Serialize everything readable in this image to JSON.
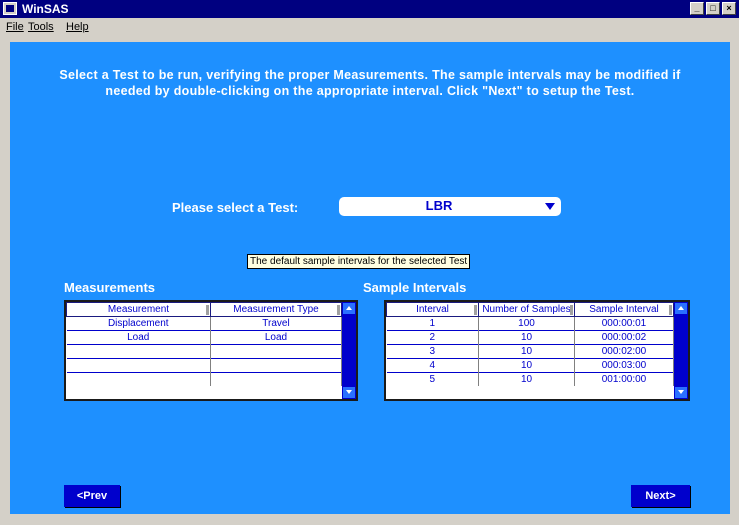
{
  "window": {
    "title": "WinSAS",
    "min_glyph": "_",
    "max_glyph": "□",
    "close_glyph": "×"
  },
  "menu": {
    "file": "File",
    "tools": "Tools",
    "help": "Help"
  },
  "instructions": "Select a Test to be run, verifying the proper Measurements.  The sample intervals may be modified if needed by double-clicking on the appropriate interval.  Click \"Next\" to setup the Test.",
  "test_select": {
    "label": "Please select a Test:",
    "value": "LBR"
  },
  "measurements": {
    "title": "Measurements",
    "columns": [
      "Measurement",
      "Measurement Type"
    ],
    "rows": [
      [
        "Displacement",
        "Travel"
      ],
      [
        "Load",
        "Load"
      ],
      [
        "",
        ""
      ],
      [
        "",
        ""
      ],
      [
        "",
        ""
      ]
    ]
  },
  "sample_intervals": {
    "title": "Sample Intervals",
    "columns": [
      "Interval",
      "Number of Samples",
      "Sample Interval"
    ],
    "rows": [
      [
        "1",
        "100",
        "000:00:01"
      ],
      [
        "2",
        "10",
        "000:00:02"
      ],
      [
        "3",
        "10",
        "000:02:00"
      ],
      [
        "4",
        "10",
        "000:03:00"
      ],
      [
        "5",
        "10",
        "001:00:00"
      ]
    ]
  },
  "tooltip": "The default sample intervals for the selected Test",
  "buttons": {
    "prev": "<Prev",
    "next": "Next>"
  },
  "colors": {
    "background": "#1e90ff",
    "accent": "#0000cc",
    "titlebar": "#000080"
  }
}
